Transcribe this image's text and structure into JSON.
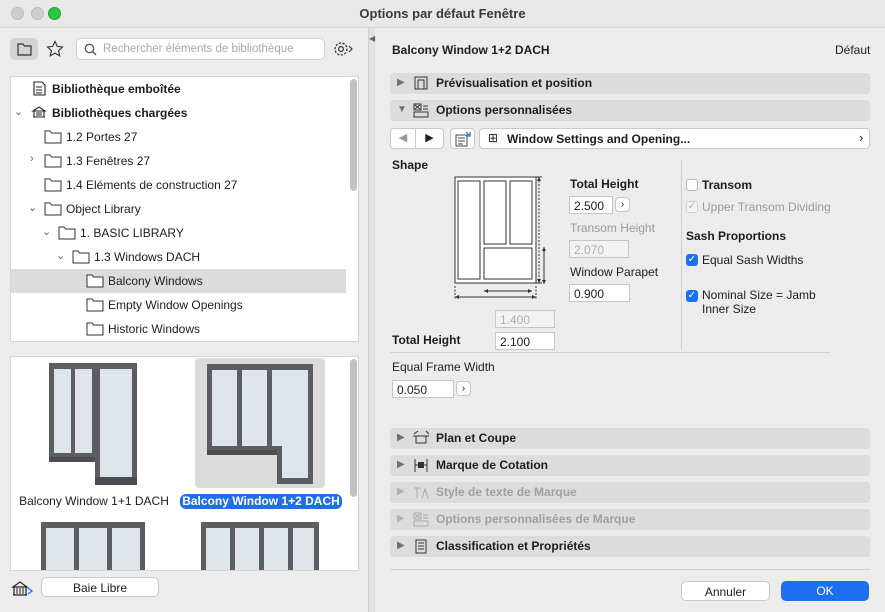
{
  "window": {
    "title": "Options par défaut Fenêtre"
  },
  "left": {
    "search_placeholder": "Rechercher éléments de bibliothèque",
    "tree": [
      {
        "label": "Bibliothèque emboîtée",
        "bold": true
      },
      {
        "label": "Bibliothèques chargées",
        "bold": true
      },
      {
        "label": "1.2 Portes 27"
      },
      {
        "label": "1.3 Fenêtres 27"
      },
      {
        "label": "1.4 Eléments de construction 27"
      },
      {
        "label": "Object Library"
      },
      {
        "label": "1. BASIC LIBRARY"
      },
      {
        "label": "1.3 Windows DACH"
      },
      {
        "label": "Balcony Windows",
        "selected": true
      },
      {
        "label": "Empty Window Openings"
      },
      {
        "label": "Historic Windows"
      }
    ],
    "thumbs": [
      {
        "label": "Balcony Window 1+1 DACH",
        "selected": false
      },
      {
        "label": "Balcony Window 1+2 DACH",
        "selected": true
      }
    ],
    "bottom_button": "Baie Libre"
  },
  "right": {
    "header_title": "Balcony Window 1+2 DACH",
    "header_default": "Défaut",
    "sections_top": [
      {
        "label": "Prévisualisation et position",
        "expanded": false
      },
      {
        "label": "Options personnalisées",
        "expanded": true
      }
    ],
    "nav": {
      "dropdown": "Window Settings and Opening..."
    },
    "shape": {
      "label": "Shape",
      "total_height_label": "Total Height",
      "total_height_value": "2.500",
      "transom_height_label": "Transom Height",
      "transom_height_value": "2.070",
      "parapet_label": "Window Parapet",
      "parapet_value": "0.900",
      "width_value": "1.400",
      "bottom_total_height_label": "Total Height",
      "bottom_total_height_value": "2.100",
      "frame_label": "Equal Frame Width",
      "frame_value": "0.050"
    },
    "options": {
      "transom_label": "Transom",
      "transom_checked": false,
      "upper_transom_label": "Upper Transom Dividing",
      "sash_title": "Sash Proportions",
      "equal_sash_label": "Equal Sash Widths",
      "equal_sash_checked": true,
      "nominal_label_1": "Nominal Size = Jamb",
      "nominal_label_2": "Inner Size",
      "nominal_checked": true
    },
    "sections_bottom": [
      {
        "label": "Plan et Coupe",
        "enabled": true
      },
      {
        "label": "Marque de Cotation",
        "enabled": true
      },
      {
        "label": "Style de texte de Marque",
        "enabled": false
      },
      {
        "label": "Options personnalisées de Marque",
        "enabled": false
      },
      {
        "label": "Classification et Propriétés",
        "enabled": true
      }
    ],
    "cancel_label": "Annuler",
    "ok_label": "OK"
  },
  "colors": {
    "accent": "#1e6ff0",
    "selection_row": "#dcdcdc",
    "close": "#c8c8c8",
    "zoom": "#28c840"
  }
}
